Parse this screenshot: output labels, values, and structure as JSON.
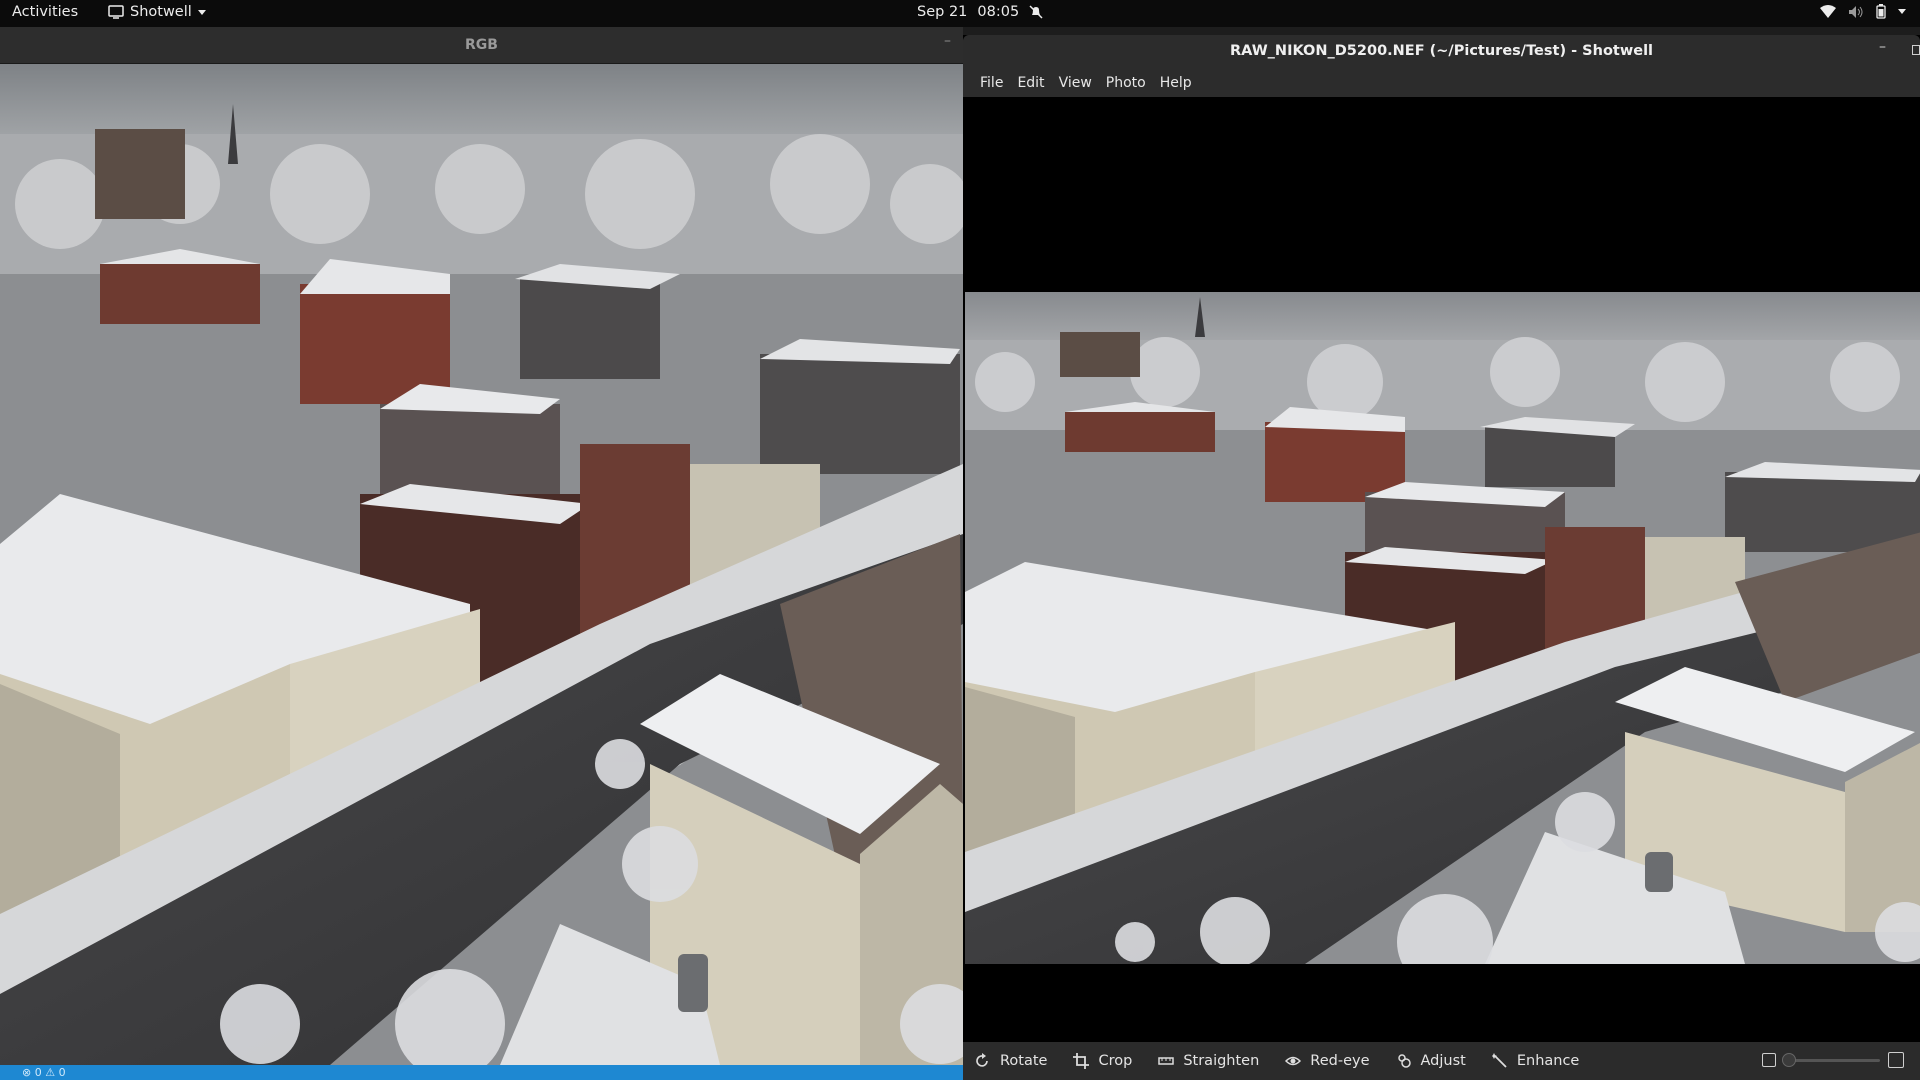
{
  "topbar": {
    "activities": "Activities",
    "app_name": "Shotwell",
    "date": "Sep 21",
    "time": "08:05"
  },
  "rgb_window": {
    "title": "RGB",
    "status_errors": "0",
    "status_warnings": "0"
  },
  "shotwell": {
    "title": "RAW_NIKON_D5200.NEF (~/Pictures/Test) - Shotwell",
    "menus": [
      "File",
      "Edit",
      "View",
      "Photo",
      "Help"
    ],
    "toolbar": {
      "rotate": "Rotate",
      "crop": "Crop",
      "straighten": "Straighten",
      "redeye": "Red-eye",
      "adjust": "Adjust",
      "enhance": "Enhance"
    },
    "zoom_level": 0.05
  },
  "colors": {
    "accent": "#1e88d2",
    "sky": "#8f9296",
    "snow": "#e6e7e9",
    "brick": "#6e3a30"
  }
}
